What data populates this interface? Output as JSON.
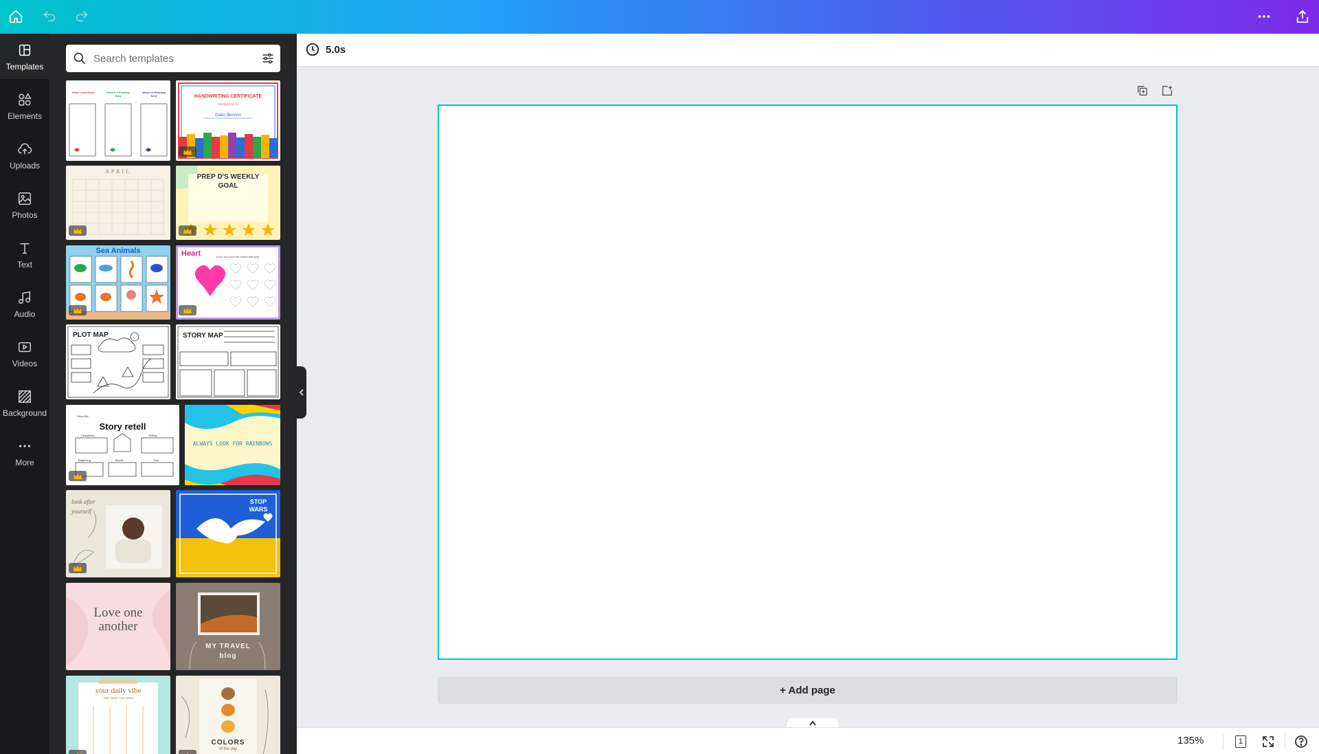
{
  "rail": {
    "items": [
      {
        "label": "Templates",
        "icon": "templates-icon"
      },
      {
        "label": "Elements",
        "icon": "elements-icon"
      },
      {
        "label": "Uploads",
        "icon": "uploads-icon"
      },
      {
        "label": "Photos",
        "icon": "photos-icon"
      },
      {
        "label": "Text",
        "icon": "text-icon"
      },
      {
        "label": "Audio",
        "icon": "audio-icon"
      },
      {
        "label": "Videos",
        "icon": "videos-icon"
      },
      {
        "label": "Background",
        "icon": "background-icon"
      },
      {
        "label": "More",
        "icon": "more-icon"
      }
    ]
  },
  "panel": {
    "search_placeholder": "Search templates",
    "templates": [
      {
        "t1": "What I Just Read",
        "t2": "What I'm Reading Now",
        "t3": "What I'm Reading Next"
      },
      {
        "title": "HANDWRITING CERTIFICATE",
        "subtitle": "PRESENTED TO",
        "name": "Daiko Bennon"
      },
      {
        "title": "APRIL"
      },
      {
        "title": "PREP D'S WEEKLY GOAL"
      },
      {
        "title": "Sea Animals",
        "labels": [
          "turtle",
          "dolphin",
          "sea horse",
          "fish",
          "crab",
          "crab",
          "jellyfish",
          "starfish"
        ]
      },
      {
        "title": "Heart",
        "subtitle": "Trace and color the hearts with pink."
      },
      {
        "title": "PLOT MAP"
      },
      {
        "title": "STORY MAP"
      },
      {
        "title": "Story retell",
        "labels": [
          "Story title",
          "Characters",
          "Setting",
          "Beginning",
          "Middle",
          "End"
        ]
      },
      {
        "title": "ALWAYS LOOK FOR RAINBOWS"
      },
      {
        "title": "look after yourself"
      },
      {
        "title": "STOP WARS"
      },
      {
        "title": "Love one another"
      },
      {
        "title": "MY TRAVEL blog"
      },
      {
        "title": "your daily vibe",
        "subtitle": "TIME WHAT YOU NEED"
      },
      {
        "title": "COLORS",
        "subtitle": "of the day"
      }
    ]
  },
  "editor": {
    "duration": "5.0s",
    "add_page_label": "+ Add page",
    "zoom": "135%",
    "page_count": "1"
  },
  "colors": {
    "accent": "#00c4cc",
    "brand_purple": "#7d2ae8",
    "rail_bg": "#18191b",
    "panel_bg": "#252627",
    "crown": "#f7b500"
  }
}
